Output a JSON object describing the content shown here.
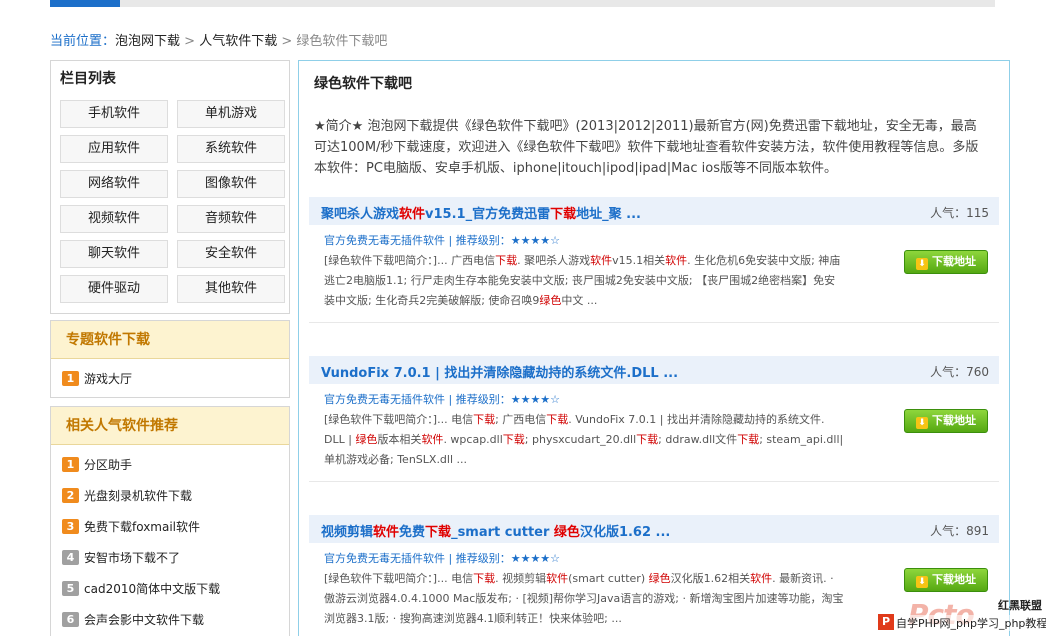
{
  "breadcrumb": {
    "label": "当前位置：",
    "items": [
      "泡泡网下载",
      "人气软件下载",
      "绿色软件下载吧"
    ],
    "separator": ">"
  },
  "categories": {
    "title": "栏目列表",
    "items": [
      "手机软件",
      "单机游戏",
      "应用软件",
      "系统软件",
      "网络软件",
      "图像软件",
      "视频软件",
      "音频软件",
      "聊天软件",
      "安全软件",
      "硬件驱动",
      "其他软件"
    ]
  },
  "topics": {
    "title": "专题软件下载",
    "items": [
      {
        "num": "1",
        "label": "游戏大厅"
      }
    ]
  },
  "related": {
    "title": "相关人气软件推荐",
    "items": [
      {
        "num": "1",
        "label": "分区助手"
      },
      {
        "num": "2",
        "label": "光盘刻录机软件下载"
      },
      {
        "num": "3",
        "label": "免费下载foxmail软件"
      },
      {
        "num": "4",
        "label": "安智市场下载不了"
      },
      {
        "num": "5",
        "label": "cad2010简体中文版下载"
      },
      {
        "num": "6",
        "label": "会声会影中文软件下载"
      }
    ]
  },
  "main": {
    "title": "绿色软件下载吧",
    "intro": "★简介★ 泡泡网下载提供《绿色软件下载吧》(2013|2012|2011)最新官方(网)免费迅雷下载地址，安全无毒，最高可达100M/秒下载速度，欢迎进入《绿色软件下载吧》软件下载地址查看软件安装方法，软件使用教程等信息。多版本软件：PC电脑版、安卓手机版、iphone|itouch|ipod|ipad|Mac ios版等不同版本软件。",
    "download_label": "下载地址",
    "entries": [
      {
        "title_parts": [
          "聚吧杀人游戏",
          "软件",
          "v15.1_官方免费迅雷",
          "下载",
          "地址_聚 ..."
        ],
        "popularity": "人气：115",
        "meta_tags": "官方免费无毒无插件软件",
        "meta_sep": "|",
        "rating_label": "推荐级别：",
        "stars": "★★★★☆",
        "desc_parts": [
          "[绿色软件下载吧简介：]... 广西电信",
          "下载",
          ". 聚吧杀人游戏",
          "软件",
          "v15.1相关",
          "软件",
          ". 生化危机6免安装中文版; 神庙逃亡2电脑版1.1; 行尸走肉生存本能免安装中文版; 丧尸围城2免安装中文版; 【丧尸围城2绝密档案】免安装中文版; 生化奇兵2完美破解版; 使命召唤9",
          "绿色",
          "中文 ..."
        ]
      },
      {
        "title_parts": [
          "VundoFix 7.0.1 | 找出并清除隐藏劫持的系统文件.DLL ..."
        ],
        "popularity": "人气：760",
        "meta_tags": "官方免费无毒无插件软件",
        "meta_sep": "|",
        "rating_label": "推荐级别：",
        "stars": "★★★★☆",
        "desc_parts": [
          "[绿色软件下载吧简介：]... 电信",
          "下载",
          "; 广西电信",
          "下载",
          ". VundoFix 7.0.1 | 找出并清除隐藏劫持的系统文件. DLL | ",
          "绿色",
          "版本相关",
          "软件",
          ". wpcap.dll",
          "下载",
          "; physxcudart_20.dll",
          "下载",
          "; ddraw.dll文件",
          "下载",
          "; steam_api.dll|单机游戏必备; TenSLX.dll ..."
        ]
      },
      {
        "title_parts": [
          "视频剪辑",
          "软件",
          "免费",
          "下载",
          "_smart cutter ",
          "绿色",
          "汉化版1.62 ..."
        ],
        "popularity": "人气：891",
        "meta_tags": "官方免费无毒无插件软件",
        "meta_sep": "|",
        "rating_label": "推荐级别：",
        "stars": "★★★★☆",
        "desc_parts": [
          "[绿色软件下载吧简介：]... 电信",
          "下载",
          ". 视频剪辑",
          "软件",
          "(smart cutter) ",
          "绿色",
          "汉化版1.62相关",
          "软件",
          ". 最新资讯. · 傲游云浏览器4.0.4.1000 Mac版发布; · [视频]帮你学习Java语言的游戏; · 新增淘宝图片加速等功能，淘宝浏览器3.1版; · 搜狗高速浏览器4.1顺利转正！快来体验吧; ..."
        ]
      }
    ]
  },
  "watermark": {
    "big": "Pcto",
    "side": [
      "红黑联盟"
    ],
    "badge": "P",
    "site": "自学PHP网_php学习_php教程"
  },
  "colors": {
    "accent": "#1c6fc9",
    "highlight": "#e00000",
    "topic_header": "#fdf3d0",
    "download_green": "#55a812"
  }
}
